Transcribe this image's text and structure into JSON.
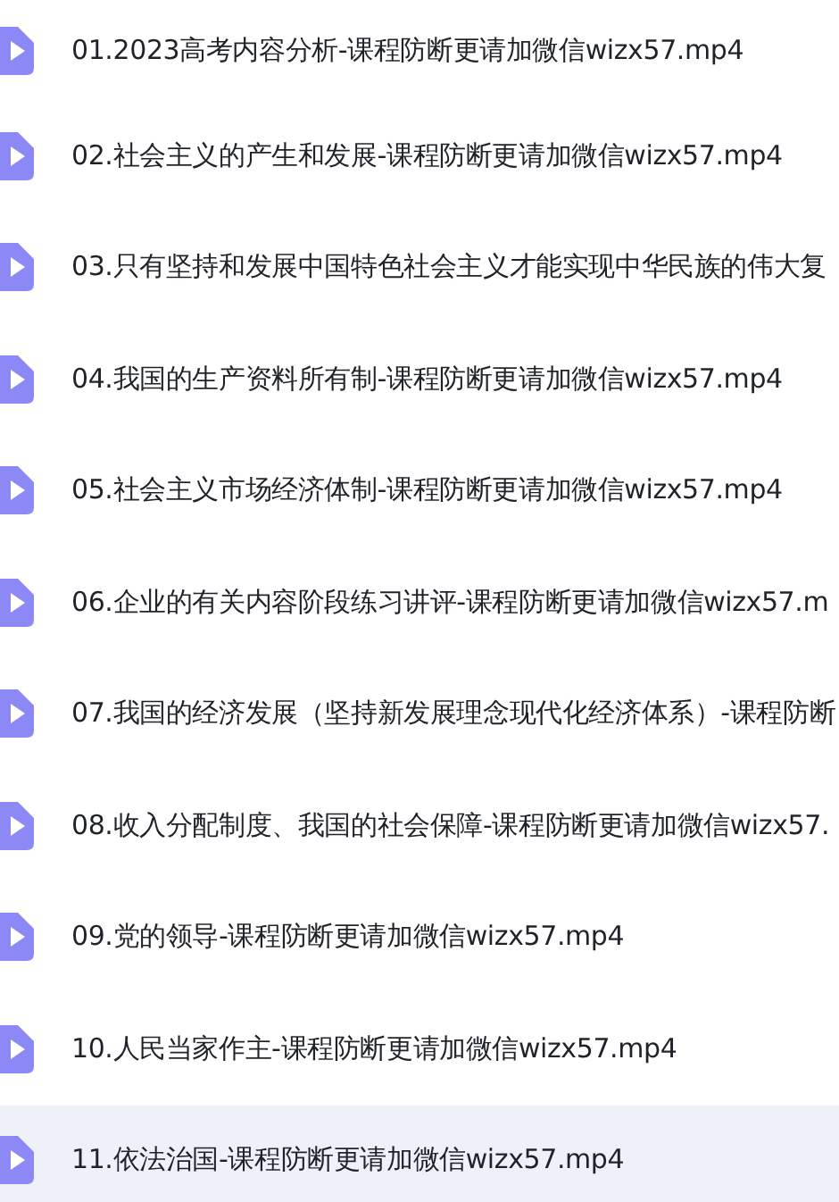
{
  "files": [
    {
      "name": "01.2023高考内容分析-课程防断更请加微信wizx57.mp4",
      "selected": false
    },
    {
      "name": "02.社会主义的产生和发展-课程防断更请加微信wizx57.mp4",
      "selected": false
    },
    {
      "name": "03.只有坚持和发展中国特色社会主义才能实现中华民族的伟大复",
      "selected": false
    },
    {
      "name": "04.我国的生产资料所有制-课程防断更请加微信wizx57.mp4",
      "selected": false
    },
    {
      "name": "05.社会主义市场经济体制-课程防断更请加微信wizx57.mp4",
      "selected": false
    },
    {
      "name": "06.企业的有关内容阶段练习讲评-课程防断更请加微信wizx57.m",
      "selected": false
    },
    {
      "name": "07.我国的经济发展（坚持新发展理念现代化经济体系）-课程防断",
      "selected": false
    },
    {
      "name": "08.收入分配制度、我国的社会保障-课程防断更请加微信wizx57.",
      "selected": false
    },
    {
      "name": "09.党的领导-课程防断更请加微信wizx57.mp4",
      "selected": false
    },
    {
      "name": "10.人民当家作主-课程防断更请加微信wizx57.mp4",
      "selected": false
    },
    {
      "name": "11.依法治国-课程防断更请加微信wizx57.mp4",
      "selected": true
    }
  ]
}
